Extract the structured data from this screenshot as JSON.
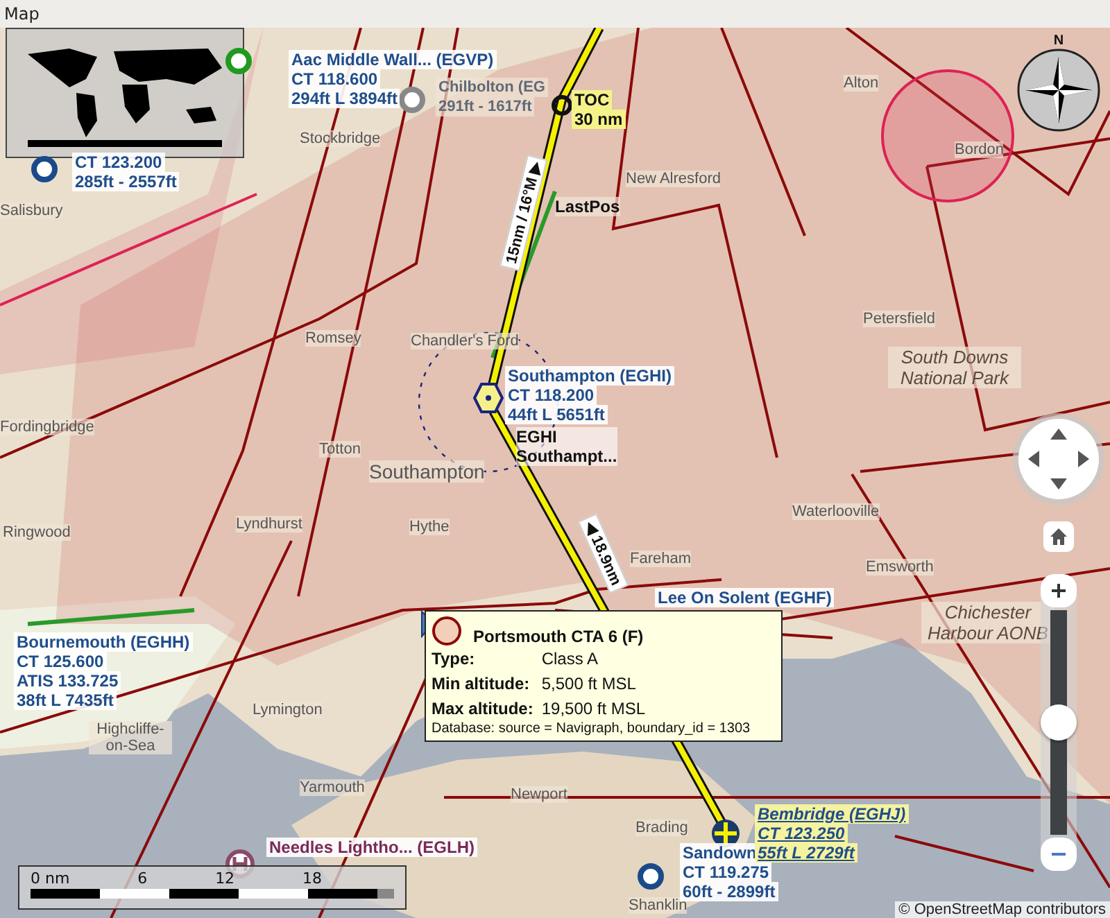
{
  "window": {
    "title": "Map"
  },
  "places": [
    {
      "kind": "town",
      "name": "Alton"
    },
    {
      "kind": "town",
      "name": "Stockbridge"
    },
    {
      "kind": "town",
      "name": "Bordon"
    },
    {
      "kind": "town",
      "name": "New Alresford"
    },
    {
      "kind": "town",
      "name": "Salisbury"
    },
    {
      "kind": "town",
      "name": "Petersfield"
    },
    {
      "kind": "town",
      "name": "Romsey"
    },
    {
      "kind": "town",
      "name": "Chandler's Ford"
    },
    {
      "kind": "park",
      "name": "South Downs National Park"
    },
    {
      "kind": "town",
      "name": "Fordingbridge"
    },
    {
      "kind": "town",
      "name": "Totton"
    },
    {
      "kind": "city",
      "name": "Southampton"
    },
    {
      "kind": "town",
      "name": "Waterlooville"
    },
    {
      "kind": "town",
      "name": "Ringwood"
    },
    {
      "kind": "town",
      "name": "Lyndhurst"
    },
    {
      "kind": "town",
      "name": "Hythe"
    },
    {
      "kind": "town",
      "name": "Fareham"
    },
    {
      "kind": "town",
      "name": "Emsworth"
    },
    {
      "kind": "park",
      "name": "Chichester Harbour AONB"
    },
    {
      "kind": "town",
      "name": "Highcliffe-on-Sea"
    },
    {
      "kind": "town",
      "name": "Lymington"
    },
    {
      "kind": "town",
      "name": "Yarmouth"
    },
    {
      "kind": "town",
      "name": "Newport"
    },
    {
      "kind": "town",
      "name": "Brading"
    },
    {
      "kind": "town",
      "name": "Shanklin"
    }
  ],
  "airports": [
    {
      "kind": "airport",
      "lines": [
        "Aac Middle Wall... (EGVP)",
        "CT 118.600",
        "294ft L 3894ft"
      ]
    },
    {
      "kind": "faded",
      "lines": [
        "Chilbolton (EG",
        "291ft - 1617ft"
      ]
    },
    {
      "kind": "airport",
      "lines": [
        "CT 123.200",
        "285ft - 2557ft"
      ]
    },
    {
      "kind": "airport",
      "lines": [
        "Southampton (EGHI)",
        "CT 118.200",
        "44ft L 5651ft"
      ]
    },
    {
      "kind": "airport",
      "lines": [
        "Bournemouth (EGHH)",
        "CT 125.600",
        "ATIS 133.725",
        "38ft L 7435ft"
      ]
    },
    {
      "kind": "airport",
      "lines": [
        "Lee On Solent (EGHF)"
      ]
    },
    {
      "kind": "heliport",
      "lines": [
        "Needles Lightho... (EGLH)"
      ]
    },
    {
      "kind": "airport",
      "lines": [
        "Sandown",
        "CT 119.275",
        "60ft - 2899ft"
      ]
    },
    {
      "kind": "highlight",
      "lines": [
        "Bembridge (EGHJ)",
        "CT 123.250",
        "55ft L 2729ft"
      ]
    }
  ],
  "route": {
    "toc": [
      "TOC",
      "30 nm"
    ],
    "last_position": "LastPos",
    "legs": [
      "15nm / 16°M ▶",
      "◀ 18.9nm"
    ],
    "navaid": [
      "EGHI",
      "Southampt..."
    ]
  },
  "tooltip": {
    "title": "Portsmouth CTA 6 (F)",
    "rows": [
      {
        "label": "Type:",
        "value": "Class A"
      },
      {
        "label": "Min altitude:",
        "value": "5,500 ft MSL"
      },
      {
        "label": "Max altitude:",
        "value": "19,500 ft MSL"
      }
    ],
    "footer": "Database: source = Navigraph, boundary_id = 1303"
  },
  "compass": {
    "north": "N"
  },
  "zoom": {
    "level": 0.5
  },
  "scale": {
    "ticks": [
      "0 nm",
      "6",
      "12",
      "18"
    ]
  },
  "attribution": "© OpenStreetMap contributors"
}
